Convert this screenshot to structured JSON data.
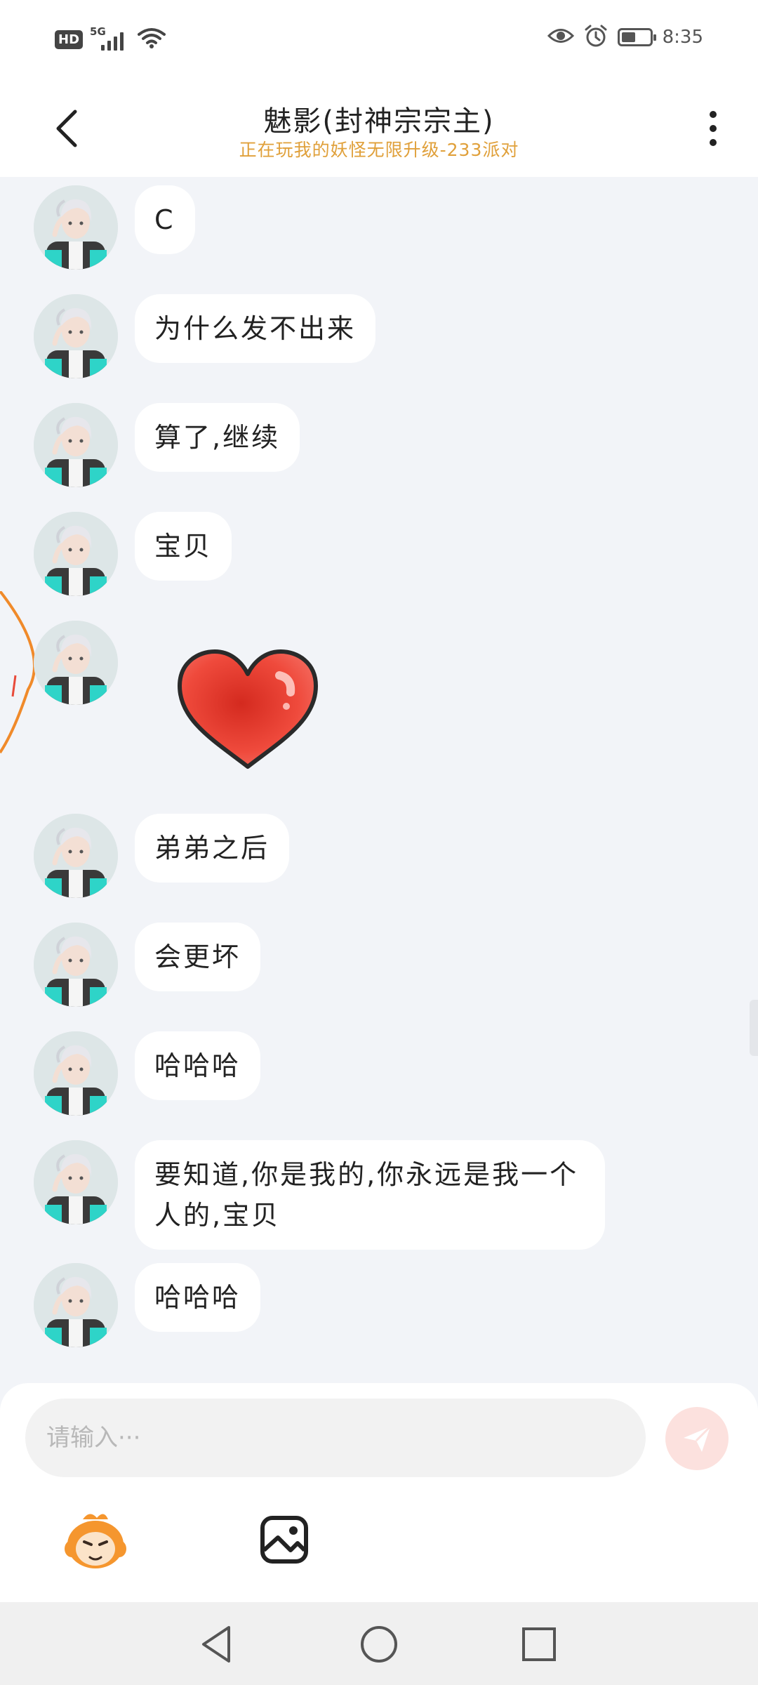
{
  "status_bar": {
    "hd_badge": "HD",
    "network": "5G",
    "icons": [
      "wifi-icon",
      "eye-icon",
      "alarm-icon",
      "battery-icon"
    ],
    "battery_level": 0.45,
    "time": "8:35"
  },
  "header": {
    "title": "魅影(封神宗宗主)",
    "subtitle": "正在玩我的妖怪无限升级-233派对",
    "back_icon": "chevron-left-icon",
    "more_icon": "more-vertical-icon"
  },
  "messages": [
    {
      "type": "text",
      "text": "C"
    },
    {
      "type": "text",
      "text": "为什么发不出来"
    },
    {
      "type": "text",
      "text": "算了,继续"
    },
    {
      "type": "text",
      "text": "宝贝"
    },
    {
      "type": "sticker",
      "sticker": "heart-sticker"
    },
    {
      "type": "text",
      "text": "弟弟之后"
    },
    {
      "type": "text",
      "text": "会更坏"
    },
    {
      "type": "text",
      "text": "哈哈哈"
    },
    {
      "type": "text",
      "text": "要知道,你是我的,你永远是我一个人的,宝贝"
    },
    {
      "type": "text",
      "text": "哈哈哈"
    }
  ],
  "input": {
    "placeholder": "请输入···",
    "value": "",
    "send_icon": "send-icon",
    "emoji_icon": "emoji-mascot-icon",
    "image_icon": "image-icon"
  },
  "nav_bar": {
    "icons": [
      "nav-back-icon",
      "nav-home-icon",
      "nav-recents-icon"
    ]
  },
  "colors": {
    "accent_orange": "#e0a03a",
    "chat_background": "#f2f4f8",
    "bubble_background": "#ffffff",
    "send_button": "#fce1de",
    "heart_red": "#e8372a"
  }
}
